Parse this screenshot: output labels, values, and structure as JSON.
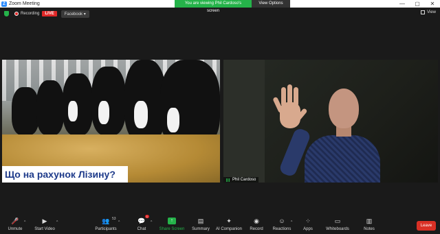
{
  "window": {
    "title": "Zoom Meeting",
    "banner_text": "You are viewing Phil Cardoso's screen",
    "view_options_label": "View Options",
    "controls": [
      "—",
      "▢",
      "✕"
    ]
  },
  "topbar": {
    "recording_label": "Recording",
    "live_label": "LIVE",
    "stream_target": "Facebook",
    "view_label": "View"
  },
  "shared_screen": {
    "caption": "Що на рахунок Лізину?"
  },
  "speaker": {
    "name": "Phil Cardoso"
  },
  "toolbar": {
    "unmute": "Unmute",
    "start_video": "Start Video",
    "participants": "Participants",
    "participants_count": "53",
    "chat": "Chat",
    "chat_badge": "1",
    "share_screen": "Share Screen",
    "summary": "Summary",
    "ai_companion": "AI Companion",
    "record": "Record",
    "reactions": "Reactions",
    "apps": "Apps",
    "whiteboards": "Whiteboards",
    "notes": "Notes",
    "leave": "Leave"
  },
  "colors": {
    "accent_green": "#25b34a",
    "live_red": "#e02828",
    "leave_red": "#d93025",
    "background": "#1a1a1a"
  }
}
